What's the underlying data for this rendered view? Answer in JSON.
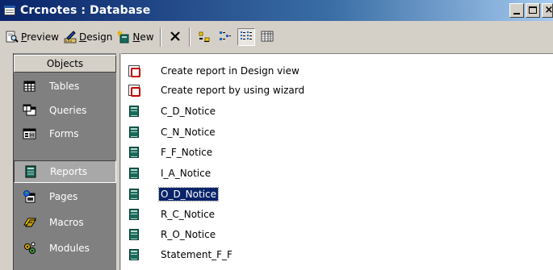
{
  "window": {
    "title": "Crcnotes : Database"
  },
  "toolbar": {
    "preview_label": "review",
    "preview_mnemonic": "P",
    "design_label": "esign",
    "design_mnemonic": "D",
    "design_prefix": "",
    "new_label": "ew",
    "new_mnemonic": "N"
  },
  "objects": {
    "header": "Objects",
    "items": [
      {
        "label": "Tables",
        "icon": "table-icon"
      },
      {
        "label": "Queries",
        "icon": "query-icon"
      },
      {
        "label": "Forms",
        "icon": "form-icon"
      },
      {
        "label": "Reports",
        "icon": "report-icon",
        "selected": true
      },
      {
        "label": "Pages",
        "icon": "page-icon"
      },
      {
        "label": "Macros",
        "icon": "macro-icon"
      },
      {
        "label": "Modules",
        "icon": "module-icon"
      }
    ]
  },
  "reports": {
    "items": [
      {
        "label": "Create report in Design view",
        "icon": "wizard-icon"
      },
      {
        "label": "Create report by using wizard",
        "icon": "wizard-icon"
      },
      {
        "label": "C_D_Notice",
        "icon": "report-icon"
      },
      {
        "label": "C_N_Notice",
        "icon": "report-icon"
      },
      {
        "label": "F_F_Notice",
        "icon": "report-icon"
      },
      {
        "label": "I_A_Notice",
        "icon": "report-icon"
      },
      {
        "label": "O_D_Notice",
        "icon": "report-icon",
        "selected": true
      },
      {
        "label": "R_C_Notice",
        "icon": "report-icon"
      },
      {
        "label": "R_O_Notice",
        "icon": "report-icon"
      },
      {
        "label": "Statement_F_F",
        "icon": "report-icon"
      }
    ]
  }
}
